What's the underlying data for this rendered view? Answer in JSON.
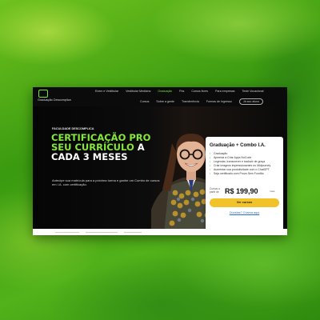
{
  "header": {
    "brand": "Graduação Descomplica",
    "nav_top": [
      "Enem e Vestibular",
      "Vestibular Medicina",
      "Graduação",
      "Pós",
      "Cursos livres",
      "Para empresas",
      "Teste Vocacional"
    ],
    "nav_active_index": 2,
    "nav_sub": [
      "Cursos",
      "Sobre a gente",
      "Transferência",
      "Formas de Ingresso"
    ],
    "signin": "Já sou aluno"
  },
  "hero": {
    "eyebrow": "FACULDADE DESCOMPLICA",
    "headline_green": "CERTIFICAÇÃO PRO SEU CURRÍCULO",
    "headline_white_1": "A",
    "headline_white_2": "CADA 3 MESES",
    "description": "Antecipe sua matrícula para a próxima turma e ganhe um Combo de cursos em I.A. com certificação."
  },
  "offer": {
    "title": "Graduação + Combo I.A.",
    "features": [
      "Graduação",
      "Aprenda a Criar Apps NoCode",
      "Legendar, transcrever e traduzir de graça",
      "Criar imagens impressionantes no Midjourney",
      "Aumentar sua produtividade com o ChatGPT",
      "Seja certificado com Prova Sem Fundão"
    ],
    "price_label": "Cursos a partir de",
    "price": "R$ 199,90",
    "price_suffix": "/mês",
    "cta": "Ver cursos",
    "help_link": "Dúvidas? Chama aqui"
  },
  "colors": {
    "accent_green": "#86e63a",
    "cta_yellow": "#f2c22b",
    "background": "#0b0b0b"
  }
}
